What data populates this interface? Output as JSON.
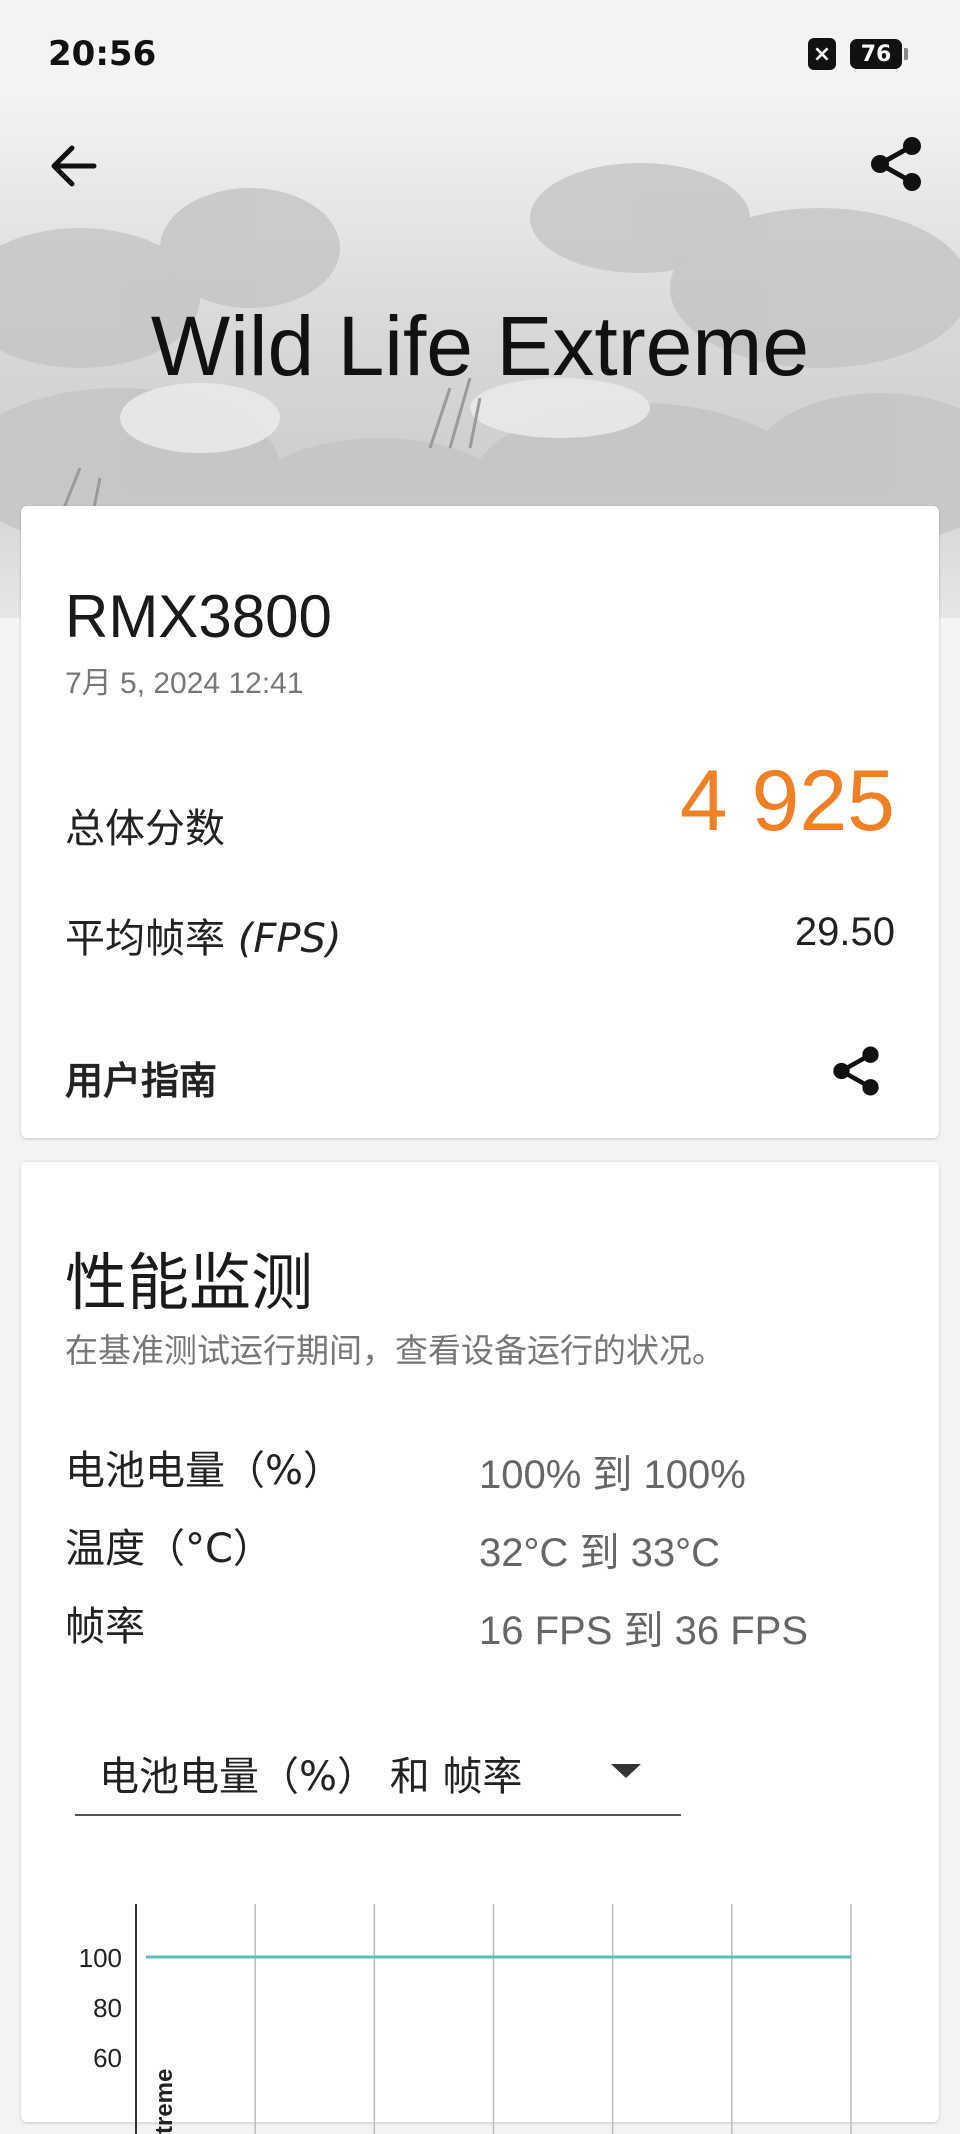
{
  "status_bar": {
    "time": "20:56",
    "sim_icon": "sim-disabled-icon",
    "battery_level": "76"
  },
  "header": {
    "title": "Wild Life Extreme",
    "back_icon": "arrow-left-icon",
    "share_icon": "share-icon"
  },
  "result_card": {
    "device": "RMX3800",
    "date": "7月 5, 2024 12:41",
    "score_label": "总体分数",
    "score_value": "4 925",
    "fps_label_prefix": "平均帧率 ",
    "fps_label_unit": "(FPS)",
    "fps_value": "29.50",
    "guide_label": "用户指南",
    "accent_color": "#f08025"
  },
  "monitor_card": {
    "title": "性能监测",
    "subtitle": "在基准测试运行期间，查看设备运行的状况。",
    "stats": [
      {
        "label": "电池电量（%）",
        "value": "100% 到 100%"
      },
      {
        "label": "温度（°C）",
        "value": "32°C 到 33°C"
      },
      {
        "label": "帧率",
        "value": "16 FPS 到 36 FPS"
      }
    ],
    "dropdown_selected": "电池电量（%） 和 帧率"
  },
  "chart_data": {
    "type": "line",
    "y_ticks": [
      "100",
      "80",
      "60"
    ],
    "side_label": "treme",
    "series": [
      {
        "values": [
          100,
          100,
          100,
          100,
          100,
          100,
          100
        ],
        "color": "#5bbfb5"
      }
    ],
    "x_gridlines": 7
  }
}
